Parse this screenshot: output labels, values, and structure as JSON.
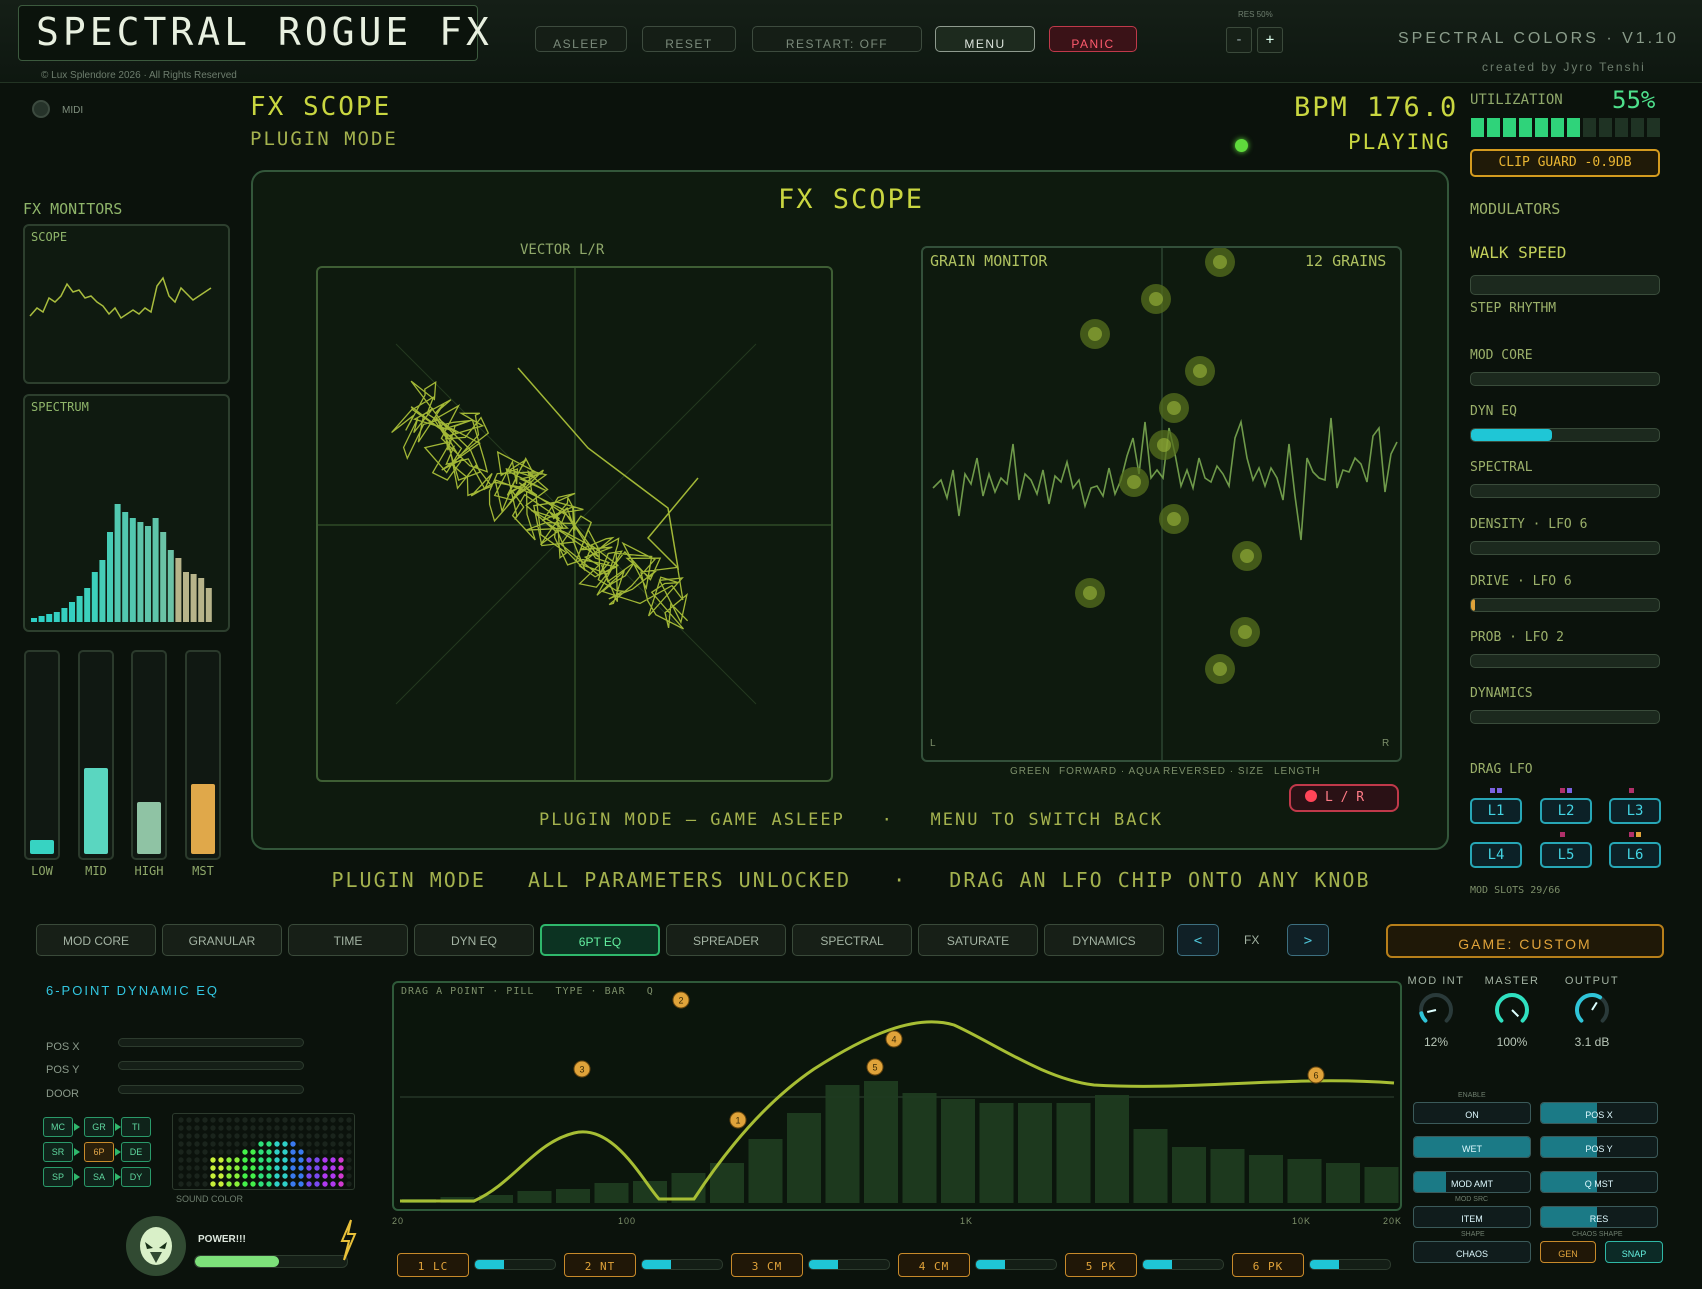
{
  "app": {
    "title": "SPECTRAL ROGUE FX",
    "copyright": "© Lux Splendore 2026 · All Rights Reserved",
    "brand": "SPECTRAL COLORS · V1.10",
    "creator": "created by Jyro Tenshi"
  },
  "topbar": {
    "buttons": [
      "ASLEEP",
      "RESET",
      "RESTART: OFF",
      "MENU",
      "PANIC"
    ],
    "res_label": "RES 50%",
    "minus": "-",
    "plus": "+"
  },
  "left": {
    "midi_label": "MIDI",
    "monitors_title": "FX MONITORS",
    "scope_title": "SCOPE",
    "spectrum_title": "SPECTRUM",
    "meters": [
      {
        "label": "LOW",
        "level": 0.07,
        "color": "#37d3c2"
      },
      {
        "label": "MID",
        "level": 0.43,
        "color": "#5ad6c0"
      },
      {
        "label": "HIGH",
        "level": 0.26,
        "color": "#8fc3a4"
      },
      {
        "label": "MST",
        "level": 0.35,
        "color": "#e0a84a"
      }
    ]
  },
  "header": {
    "title": "FX SCOPE",
    "subtitle": "PLUGIN MODE",
    "bpm": "BPM 176.0",
    "status": "PLAYING"
  },
  "scope": {
    "title": "FX SCOPE",
    "vector_label": "VECTOR  L/R",
    "grain_title": "GRAIN MONITOR",
    "grain_count": "12 GRAINS",
    "axis_left": "L",
    "axis_right": "R",
    "legend": [
      "GREEN",
      "FORWARD · AQUA",
      "REVERSED · SIZE",
      "LENGTH"
    ],
    "lr_button": "L / R",
    "footer": "PLUGIN MODE – GAME ASLEEP   ·   MENU TO SWITCH BACK"
  },
  "banner": "PLUGIN MODE   ALL PARAMETERS UNLOCKED   ·   DRAG AN LFO CHIP ONTO ANY KNOB",
  "right": {
    "utilization_label": "UTILIZATION",
    "utilization_value": "55%",
    "utilization_fraction": 0.55,
    "clip_guard": "CLIP GUARD -0.9DB",
    "modulators_title": "MODULATORS",
    "walk_speed": "WALK SPEED",
    "step_rhythm": "STEP RHYTHM",
    "mods": [
      {
        "label": "MOD CORE",
        "value": 0.0
      },
      {
        "label": "DYN EQ",
        "value": 0.43
      },
      {
        "label": "SPECTRAL",
        "value": 0.0
      },
      {
        "label": "DENSITY · LFO 6",
        "value": 0.0
      },
      {
        "label": "DRIVE · LFO 6",
        "value": 0.02
      },
      {
        "label": "PROB · LFO 2",
        "value": 0.0
      },
      {
        "label": "DYNAMICS",
        "value": 0.0
      }
    ],
    "drag_lfo": "DRAG LFO",
    "lfos": [
      "L1",
      "L2",
      "L3",
      "L4",
      "L5",
      "L6"
    ],
    "mod_slots": "MOD SLOTS 29/66"
  },
  "tabs": [
    "MOD CORE",
    "GRANULAR",
    "TIME",
    "DYN EQ",
    "6PT EQ",
    "SPREADER",
    "SPECTRAL",
    "SATURATE",
    "DYNAMICS"
  ],
  "active_tab": "6PT EQ",
  "nav": {
    "prev": "<",
    "label": "FX",
    "next": ">"
  },
  "game_custom": "GAME: CUSTOM",
  "eq": {
    "title": "6-POINT DYNAMIC EQ",
    "params": [
      "POS X",
      "POS Y",
      "DOOR"
    ],
    "nodes": [
      "MC",
      "GR",
      "TI",
      "SR",
      "6P",
      "DE",
      "SP",
      "SA",
      "DY"
    ],
    "sound_color": "SOUND COLOR",
    "power": "POWER!!!",
    "power_level": 0.55,
    "help": "DRAG A POINT · PILL   TYPE · BAR   Q",
    "freq_ticks": [
      "20",
      "100",
      "1K",
      "10K",
      "20K"
    ],
    "points": [
      "1",
      "2",
      "3",
      "4",
      "5",
      "6"
    ],
    "bands": [
      "1 LC",
      "2 NT",
      "3 CM",
      "4 CM",
      "5 PK",
      "6 PK"
    ]
  },
  "knobs": [
    {
      "label": "MOD INT",
      "value": "12%",
      "level": 0.12
    },
    {
      "label": "MASTER",
      "value": "100%",
      "level": 1.0
    },
    {
      "label": "OUTPUT",
      "value": "3.1 dB",
      "level": 0.62
    }
  ],
  "toggles": {
    "enable_label": "ENABLE",
    "on": "ON",
    "wet": "WET",
    "mod_amt": "MOD AMT",
    "mod_src_label": "MOD SRC",
    "item": "ITEM",
    "shape_label": "SHAPE",
    "chaos": "CHAOS",
    "pos_x": "POS X",
    "pos_y": "POS Y",
    "q_mst": "Q MST",
    "res": "RES",
    "chaos_shape_label": "CHAOS SHAPE",
    "gen": "GEN",
    "snap": "SNAP"
  },
  "colors": {
    "accent": "#c9d640",
    "aqua": "#1fc6d6",
    "green": "#2fd37a",
    "amber": "#e0a33a",
    "red": "#ff4558"
  }
}
